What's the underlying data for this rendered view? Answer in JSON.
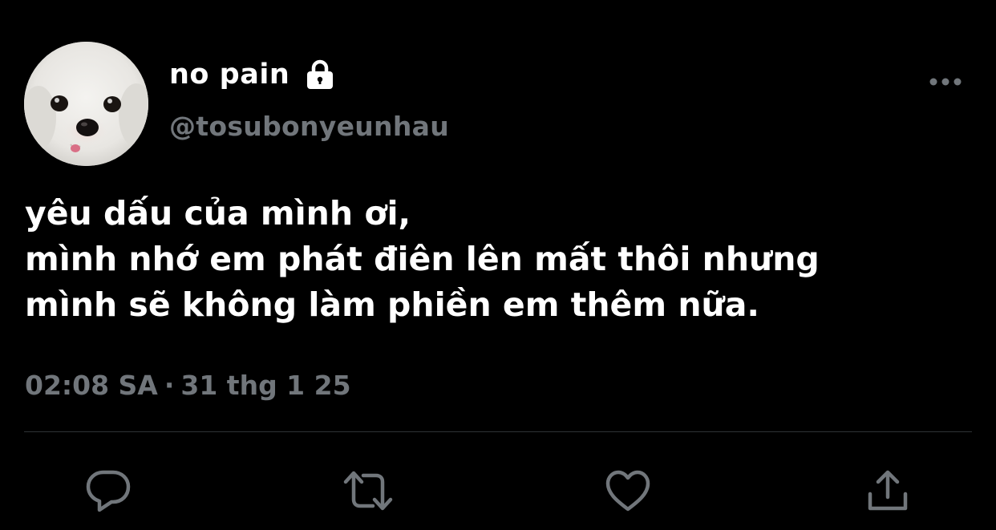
{
  "tweet": {
    "author": {
      "display_name": "no pain",
      "handle": "@tosubonyeunhau",
      "protected": true,
      "avatar": "white-puppy-photo"
    },
    "text_lines": [
      "yêu dấu của mình ơi,",
      "mình nhớ em phát điên lên mất thôi nhưng",
      "mình sẽ không làm phiền em thêm nữa."
    ],
    "time": "02:08 SA",
    "separator": "·",
    "date": "31 thg 1 25",
    "icons": {
      "lock": "lock-icon",
      "more": "more-icon",
      "reply": "reply-icon",
      "retweet": "retweet-icon",
      "like": "heart-icon",
      "share": "share-icon"
    }
  },
  "colors": {
    "background": "#000000",
    "primary_text": "#ffffff",
    "secondary_text": "#71767b",
    "icon": "#71767b",
    "divider": "#2f3336"
  }
}
